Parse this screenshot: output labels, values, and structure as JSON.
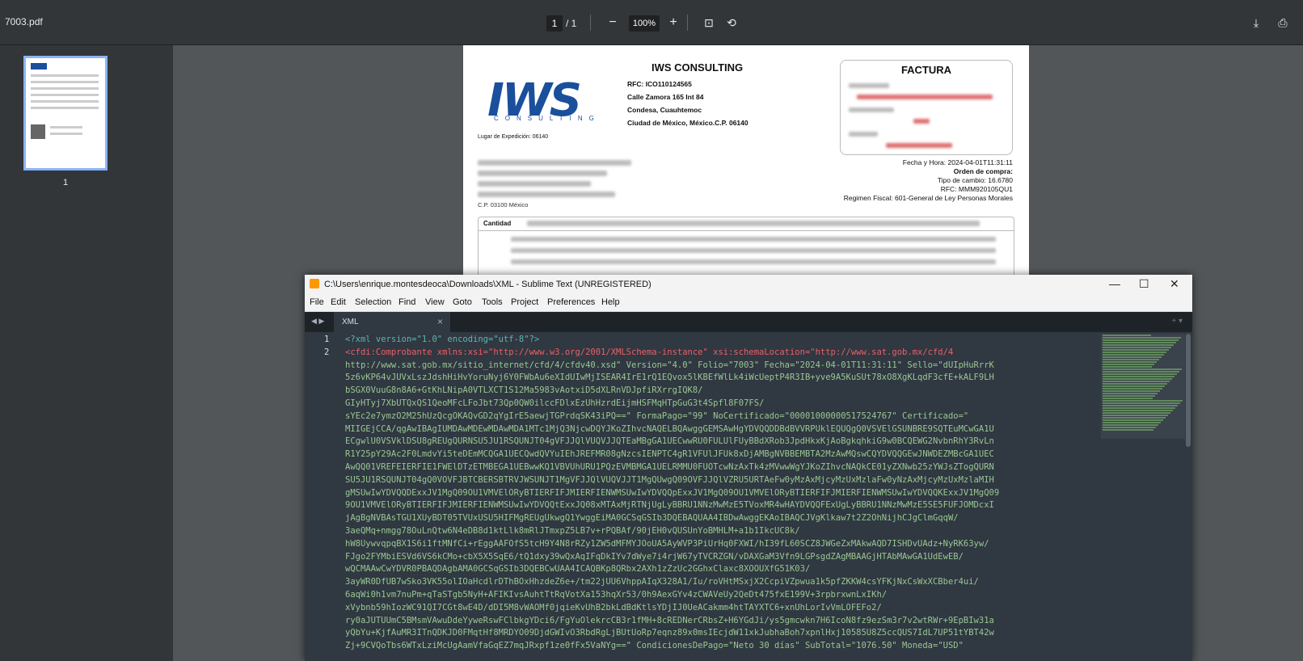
{
  "viewer": {
    "filename": "7003.pdf",
    "page_current": "1",
    "page_total": "/ 1",
    "zoom": "100%",
    "thumb_label": "1"
  },
  "invoice": {
    "company": "IWS CONSULTING",
    "logo_text": "IWS",
    "logo_sub": "CONSULTING",
    "rfc": "RFC: ICO110124565",
    "address1": "Calle Zamora 165 Int 84",
    "address2": "Condesa, Cuauhtemoc",
    "address3": "Ciudad de México, México.C.P. 06140",
    "lugar": "Lugar de Expedición: 06140",
    "factura": "FACTURA",
    "fecha": "Fecha y Hora: 2024-04-01T11:31:11",
    "orden": "Orden de compra:",
    "tipo_cambio": "Tipo de cambio: 16.6780",
    "rfc_receptor": "RFC: MMM920105QU1",
    "regimen": "Regimen Fiscal: 601-General de Ley Personas Morales",
    "cp": "C.P. 03100 México",
    "cantidad": "Cantidad"
  },
  "sublime": {
    "title": "C:\\Users\\enrique.montesdeoca\\Downloads\\XML - Sublime Text (UNREGISTERED)",
    "menu": [
      "File",
      "Edit",
      "Selection",
      "Find",
      "View",
      "Goto",
      "Tools",
      "Project",
      "Preferences",
      "Help"
    ],
    "tab": "XML",
    "line1_num": "1",
    "line2_num": "2",
    "code_lines": [
      "<?xml version=\"1.0\" encoding=\"utf-8\"?>",
      "<cfdi:Comprobante xmlns:xsi=\"http://www.w3.org/2001/XMLSchema-instance\" xsi:schemaLocation=\"http://www.sat.gob.mx/cfd/4",
      "http://www.sat.gob.mx/sitio_internet/cfd/4/cfdv40.xsd\" Version=\"4.0\" Folio=\"7003\" Fecha=\"2024-04-01T11:31:11\" Sello=\"dUIpHuRrrK",
      "5z6vKP64vJUVxLszJdshHiHvYoruNyj6Y0FWbAu6eXIdUIwMjISEAR4IrE1rQ1EQvox5lKBEfWlLk4iWcUeptP4R3IB+yve9A5KuSUt78xO8XgKLqdF3cfE+kALF9LH",
      "bSGX0VuuG8n8A6+GtKhLNipA0VTLXCT1S12Ma5983vAotxiD5dXLRnVDJpfiRXrrgIQK8/",
      "GIyHTyj7XbUTQxQS1QeoMFcLFoJbt73Qp0QW0ilccFDlxEzUhHzrdEijmHSFMqHTpGuG3t4Spfl8F07FS/",
      "sYEc2e7ymzO2M25hUzQcgOKAQvGD2qYgIrE5aewjTGPrdqSK43iPQ==\" FormaPago=\"99\" NoCertificado=\"00001000000517524767\" Certificado=\"",
      "MIIGEjCCA/qgAwIBAgIUMDAwMDEwMDAwMDA1MTc1MjQ3NjcwDQYJKoZIhvcNAQELBQAwggGEMSAwHgYDVQQDDBdBVVRPUklEQUQgQ0VSVElGSUNBRE9SQTEuMCwGA1U",
      "ECgwlU0VSVklDSU8gREUgQURNSU5JU1RSQUNJT04gVFJJQlVUQVJJQTEaMBgGA1UECwwRU0FULUlFUyBBdXRob3JpdHkxKjAoBgkqhkiG9w0BCQEWG2NvbnRhY3RvLn",
      "R1Y25pY29Ac2F0LmdvYi5teDEmMCQGA1UECQwdQVYuIEhJREFMR08gNzcsIENPTC4gR1VFUlJFUk8xDjAMBgNVBBEMBTA2MzAwMQswCQYDVQQGEwJNWDEZMBcGA1UEC",
      "AwQQ01VREFEIERFIE1FWElDTzETMBEGA1UEBwwKQ1VBVUhURU1PQzEVMBMGA1UELRMMU0FUOTcwNzAxTk4zMVwwWgYJKoZIhvcNAQkCE01yZXNwb25zYWJsZTogQURN",
      "SU5JU1RSQUNJT04gQ0VOVFJBTCBERSBTRVJWSUNJT1MgVFJJQlVUQVJJT1MgQUwgQ09OVFJJQlVZRU5URTAeFw0yMzAxMjcyMzUxMzlaFw0yNzAxMjcyMzUxMzlaMIH",
      "gMSUwIwYDVQQDExxJV1MgQ09OU1VMVElORyBTIERFIFJMIERFIENWMSUwIwYDVQQpExxJV1MgQ09OU1VMVElORyBTIERFIFJMIERFIENWMSUwIwYDVQQKExxJV1MgQ09",
      "9OU1VMVElORyBTIERFIFJMIERFIENWMSUwIwYDVQQtExxJQ08xMTAxMjRTNjUgLyBBRU1NNzMwMzE5TVoxMR4wHAYDVQQFExUgLyBBRU1NNzMwMzE5SE5FUFJOMDcxI",
      "jAgBgNVBAsTGU1XUyBDT05TVUxUSU5HIFMgREUgUkwgQ1YwggEiMA0GCSqGSIb3DQEBAQUAA4IBDwAwggEKAoIBAQCJVgKlkaw7t2Z2OhNijhCJgClmGqqW/",
      "3aeQMq+nmgg78OuLnQtw6N4eDB8d1ktLlk8mRlJTmxpZ5LB7v+rPQBAf/90jEH0vQUSUnYoBMHLM+a1b1IkcUC8k/",
      "hW8UywvqpqBX1S6i1ftMNfCi+rEggAAFOfS5tcH9Y4N8rRZy1ZW5dMFMYJOoUA5AyWVP3PiUrHq0FXWI/hI39fL60SCZ8JWGeZxMAkwAQD7ISHDvUAdz+NyRK63yw/",
      "FJgo2FYMbiESVd6VS6kCMo+cbX5X5SqE6/tQ1dxy39wQxAqIFqDkIYv7dWye7i4rjW67yTVCRZGN/vDAXGaM3Vfn9LGPsgdZAgMBAAGjHTAbMAwGA1UdEwEB/",
      "wQCMAAwCwYDVR0PBAQDAgbAMA0GCSqGSIb3DQEBCwUAA4ICAQBKp8QRbx2AXh1zZzUc2GGhxClaxc8XOOUXfG51K03/",
      "3ayWR0DfUB7wSko3VK55olIOaHcdlrDThBOxHhzdeZ6e+/tm22jUU6VhppAIqX328A1/Iu/roVHtMSxjX2CcpiVZpwua1k5pfZKKW4csYFKjNxCsWxXCBber4ui/",
      "6aqWi0h1vm7nuPm+qTaSTgb5NyH+AFIKIvsAuhtTtRqVotXa153hqXr53/0h9AexGYv4zCWAVeUy2QeDt475fxE199V+3rpbrxwnLxIKh/",
      "xVybnb59hIozWC91QI7CGt8wE4D/dDI5M8vWAOMf0jqieKvUhB2bkLdBdKtlsYDjIJ0UeACakmm4htTAYXTC6+xnUhLorIvVmLOFEFo2/",
      "ry0aJUTUUmC5BMsmVAwuDdeYyweRswFClbkgYDci6/FgYuOlekrcCB3r1fMH+8cREDNerCRbsZ+H6YGdJi/ys5gmcwkn7H6IcoN8fz9ezSm3r7v2wtRWr+9EpBIw31a",
      "yQbYu+KjfAuMR3ITnQDKJD0FMqtHf8MRDYO09DjdGWIvO3RbdRgLjBUtUoRp7eqnz89x0msIEcjdW11xkJubhaBoh7xpnlHxj10585U8Z5ccQUS7IdL7UP51tYBT42w",
      "Zj+9CVQoTbs6WTxLziMcUgAamVfaGqEZ7mqJRxpf1ze0fFx5VaNYg==\" CondicionesDePago=\"Neto 30 días\" SubTotal=\"1076.50\" Moneda=\"USD\""
    ]
  },
  "colors": {
    "accent": "#8ab4f8",
    "editor_bg": "#303841",
    "string": "#99c794"
  }
}
